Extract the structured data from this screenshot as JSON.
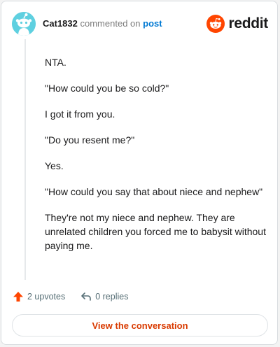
{
  "header": {
    "username": "Cat1832",
    "action": "commented on",
    "link": "post",
    "brand": "reddit"
  },
  "comment": {
    "paragraphs": [
      "NTA.",
      "\"How could you be so cold?\"",
      "I got it from you.",
      "\"Do you resent me?\"",
      "Yes.",
      "\"How could you say that about niece and nephew\"",
      "They're not my niece and nephew. They are unrelated children you forced me to babysit without paying me."
    ]
  },
  "footer": {
    "upvotes": "2 upvotes",
    "replies": "0 replies"
  },
  "cta": {
    "label": "View the conversation"
  },
  "icons": {
    "avatar": "snoo-avatar-icon",
    "brand": "reddit-logo-icon",
    "upvote": "upvote-arrow-icon",
    "reply": "reply-arrow-icon"
  },
  "colors": {
    "brand_orange": "#ff4500",
    "link_blue": "#0079d3",
    "cta_text": "#d93a00",
    "avatar_bg": "#5fd0e0"
  }
}
